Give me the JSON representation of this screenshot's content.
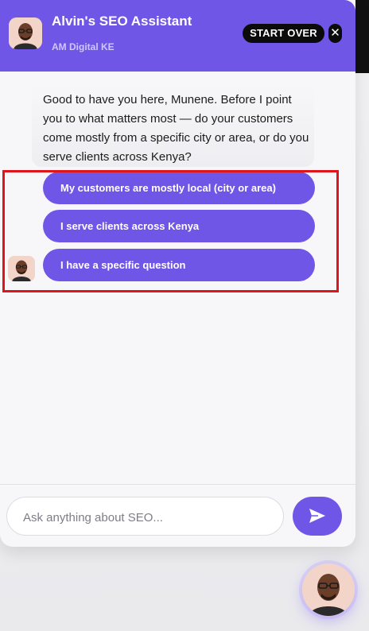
{
  "header": {
    "title": "Alvin's SEO Assistant",
    "subtitle": "AM Digital KE",
    "start_over_label": "START OVER",
    "close_label": "✕",
    "avatar_icon": "alvin-avatar",
    "accent_color": "#6f56e6"
  },
  "conversation": {
    "bot_message": "Good to have you here, Munene. Before I point you to what matters most — do your customers come mostly from a specific city or area, or do you serve clients across Kenya?",
    "options": [
      {
        "label": "My customers are mostly local (city or area)"
      },
      {
        "label": "I serve clients across Kenya"
      },
      {
        "label": "I have a specific question"
      }
    ],
    "highlight_color": "#e0141b"
  },
  "composer": {
    "placeholder": "Ask anything about SEO...",
    "value": "",
    "send_icon": "send-icon"
  },
  "launcher": {
    "icon": "alvin-avatar"
  }
}
